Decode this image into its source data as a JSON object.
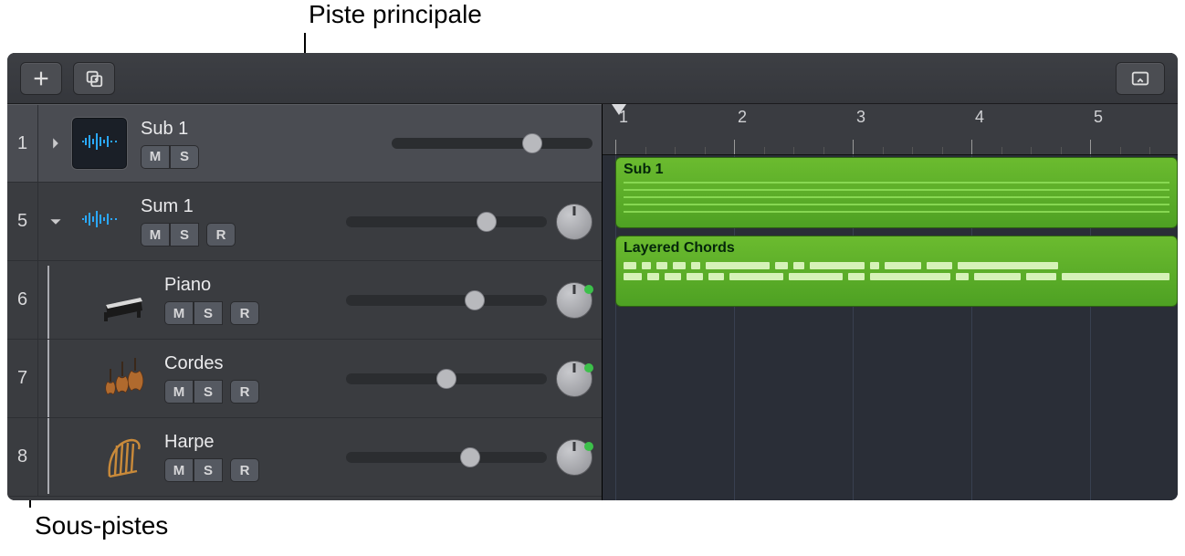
{
  "callouts": {
    "top": "Piste principale",
    "bottom": "Sous-pistes"
  },
  "toolbar": {
    "add": "add-track",
    "duplicate": "duplicate-track",
    "collapse": "collapse-tracks"
  },
  "ruler": {
    "marks": [
      "1",
      "2",
      "3",
      "4",
      "5"
    ]
  },
  "tracks": [
    {
      "num": "1",
      "name": "Sub 1",
      "kind": "audio",
      "expandable": true,
      "expanded": false,
      "selected": true,
      "buttons": [
        "M",
        "S"
      ],
      "hasRecord": false,
      "hasPan": false,
      "volPos": 0.7,
      "region": {
        "label": "Sub 1",
        "type": "audio"
      }
    },
    {
      "num": "5",
      "name": "Sum 1",
      "kind": "audio",
      "expandable": true,
      "expanded": true,
      "buttons": [
        "M",
        "S"
      ],
      "hasRecord": true,
      "hasPan": true,
      "panGreen": false,
      "volPos": 0.7,
      "region": {
        "label": "Layered Chords",
        "type": "midi"
      }
    },
    {
      "num": "6",
      "name": "Piano",
      "kind": "inst",
      "icon": "piano",
      "sub": true,
      "buttons": [
        "M",
        "S"
      ],
      "hasRecord": true,
      "hasPan": true,
      "panGreen": true,
      "volPos": 0.64
    },
    {
      "num": "7",
      "name": "Cordes",
      "kind": "inst",
      "icon": "strings",
      "sub": true,
      "buttons": [
        "M",
        "S"
      ],
      "hasRecord": true,
      "hasPan": true,
      "panGreen": true,
      "volPos": 0.5
    },
    {
      "num": "8",
      "name": "Harpe",
      "kind": "inst",
      "icon": "harp",
      "sub": true,
      "buttons": [
        "M",
        "S"
      ],
      "hasRecord": true,
      "hasPan": true,
      "panGreen": true,
      "volPos": 0.62
    }
  ],
  "midi_notes": [
    [
      14,
      10,
      12,
      14,
      10,
      70,
      14,
      12,
      60,
      10,
      40,
      28,
      110
    ],
    [
      20,
      14,
      18,
      18,
      18,
      60,
      60,
      18,
      90,
      14,
      52,
      34,
      120
    ]
  ]
}
